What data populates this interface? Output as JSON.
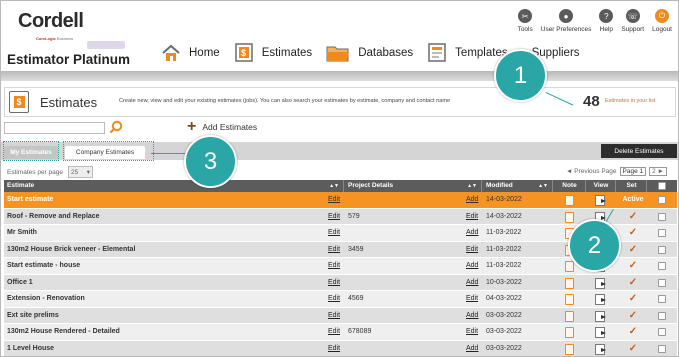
{
  "header": {
    "logo": "Cordell",
    "logo_sub_brand": "CoreLogic",
    "logo_sub_suffix": "Business",
    "app_title": "Estimator Platinum",
    "top_icons": [
      {
        "label": "Tools",
        "icon": "tools-icon",
        "glyph": "✂"
      },
      {
        "label": "User Preferences",
        "icon": "user-icon",
        "glyph": "●"
      },
      {
        "label": "Help",
        "icon": "help-icon",
        "glyph": "?"
      },
      {
        "label": "Support",
        "icon": "support-icon",
        "glyph": "☏"
      },
      {
        "label": "Logout",
        "icon": "logout-icon",
        "glyph": "⏻"
      }
    ],
    "nav": [
      {
        "label": "Home",
        "icon": "home-icon"
      },
      {
        "label": "Estimates",
        "icon": "estimates-icon"
      },
      {
        "label": "Databases",
        "icon": "folder-icon"
      },
      {
        "label": "Templates",
        "icon": "templates-icon"
      },
      {
        "label": "Suppliers",
        "icon": "suppliers-icon"
      }
    ]
  },
  "banner": {
    "title": "Estimates",
    "description": "Create new, view and edit your existing estimates (jobs). You can also search your estimates by estimate, company and contact name",
    "count": "48",
    "count_label": "Estimates in your list"
  },
  "toolbar": {
    "search_placeholder": "",
    "add_label": "Add Estimates",
    "delete_label": "Delete Estimates"
  },
  "tabs": [
    {
      "label": "My Estimates",
      "active": true
    },
    {
      "label": "Company Estimates",
      "active": false
    }
  ],
  "paging": {
    "per_page_label": "Estimates per page",
    "per_page_value": "25",
    "prev_label": "◄ Previous Page",
    "page_value": "Page 1",
    "next_value": "2 ►"
  },
  "table": {
    "columns": [
      "Estimate",
      "Project Details",
      "Modified",
      "Note",
      "View",
      "Set"
    ],
    "sort_glyph": "▲▼",
    "edit_label": "Edit",
    "add_label": "Add",
    "rows": [
      {
        "name": "Start estimate",
        "project": "",
        "proj_action": "Add",
        "modified": "14-03-2022",
        "set": "Active"
      },
      {
        "name": "Roof - Remove and Replace",
        "project": "579",
        "proj_action": "Edit",
        "modified": "14-03-2022",
        "set": "✓"
      },
      {
        "name": "Mr Smith",
        "project": "",
        "proj_action": "Add",
        "modified": "11-03-2022",
        "set": "✓"
      },
      {
        "name": "130m2 House Brick veneer - Elemental",
        "project": "3459",
        "proj_action": "Edit",
        "modified": "11-03-2022",
        "set": "✓"
      },
      {
        "name": "Start estimate - house",
        "project": "",
        "proj_action": "Add",
        "modified": "11-03-2022",
        "set": "✓"
      },
      {
        "name": "Office 1",
        "project": "",
        "proj_action": "Add",
        "modified": "10-03-2022",
        "set": "✓"
      },
      {
        "name": "Extension - Renovation",
        "project": "4569",
        "proj_action": "Edit",
        "modified": "04-03-2022",
        "set": "✓"
      },
      {
        "name": "Ext site prelims",
        "project": "",
        "proj_action": "Add",
        "modified": "03-03-2022",
        "set": "✓"
      },
      {
        "name": "130m2 House Rendered - Detailed",
        "project": "678089",
        "proj_action": "Edit",
        "modified": "03-03-2022",
        "set": "✓"
      },
      {
        "name": "1 Level House",
        "project": "",
        "proj_action": "Add",
        "modified": "03-03-2022",
        "set": "✓"
      }
    ]
  },
  "callouts": [
    "1",
    "2",
    "3"
  ],
  "colors": {
    "accent": "#f59422",
    "teal": "#2aa6a6",
    "header_dark": "#5c5c5c"
  }
}
